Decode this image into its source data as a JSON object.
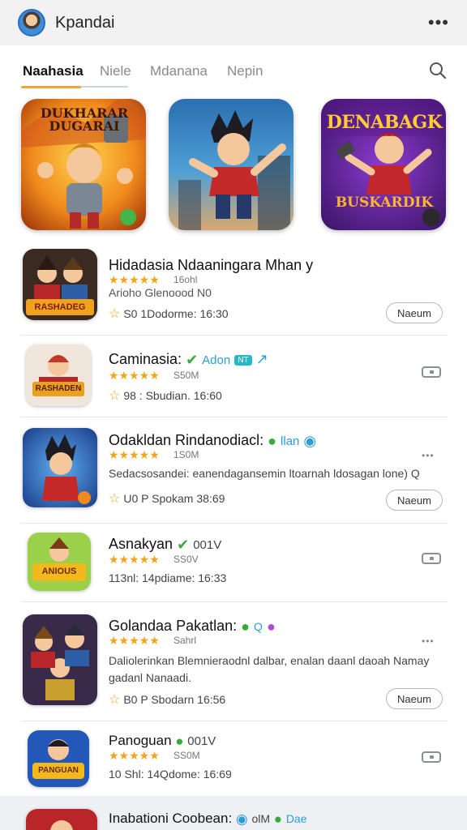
{
  "header": {
    "title": "Kpandai",
    "more": "•••"
  },
  "tabs": [
    {
      "label": "Naahasia",
      "active": true
    },
    {
      "label": "Niele",
      "active": false
    },
    {
      "label": "Mdanana",
      "active": false
    },
    {
      "label": "Nepin",
      "active": false
    }
  ],
  "featured": [
    {
      "title": "DUKHARAR DUGARAI"
    },
    {
      "title": ""
    },
    {
      "title": "DENABAGK",
      "subtitle": "BUSKARDIK"
    }
  ],
  "list": [
    {
      "name": "Hidadasia Ndaaningara Mhan y",
      "rating": "16ohl",
      "sub": "Arioho Glenoood N0",
      "meta": "S0 1Dodorme: 16:30",
      "button": "Naeum",
      "icon_text": "RASHADEG"
    },
    {
      "name": "Caminasia:",
      "badge1": "Adon",
      "rating": "S50M",
      "meta": "98 : Sbudian. 16:60",
      "icon_text": "RASHADEN"
    },
    {
      "name": "Odakldan Rindanodiacl:",
      "badge1": "llan",
      "rating": "1S0M",
      "desc": "Sedacsosandei: eanendagansemin ltoarnah ldosagan lone) Q",
      "meta": "U0 P Spokam 38:69",
      "button": "Naeum",
      "dots": "•••"
    },
    {
      "name": "Asnakyan",
      "badge1": "001V",
      "rating": "SS0V",
      "meta": "113nl: 14pdiame: 16:33",
      "icon_text": "ANIOUS"
    },
    {
      "name": "Golandaa Pakatlan:",
      "badge1": "Q",
      "rating": "Sahrl",
      "desc": "Daliolerinkan Blemnieraodnl dalbar, enalan daanl daoah Namay gadanl Nanaadi.",
      "meta": "B0 P Sbodarn 16:56",
      "button": "Naeum",
      "dots": "•••"
    },
    {
      "name": "Panoguan",
      "badge1": "001V",
      "rating": "SS0M",
      "meta": "10 Shl: 14Qdome: 16:69",
      "icon_text": "PANGUAN"
    },
    {
      "name": "Inabationi Coobean:",
      "badge1": "olM",
      "badge2": "Dae"
    }
  ],
  "stars": "★★★★★",
  "colors": {
    "accent": "#f2a23a",
    "star": "#f2a51a",
    "header_bg": "#f2f2f2"
  }
}
